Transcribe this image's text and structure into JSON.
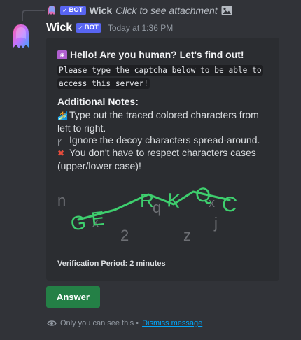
{
  "reply": {
    "author": "Wick",
    "bot_tag": "BOT",
    "text": "Click to see attachment",
    "icon": "image-icon"
  },
  "message": {
    "author": "Wick",
    "bot_tag": "BOT",
    "timestamp": "Today at 1:36 PM"
  },
  "embed": {
    "title": "Hello! Are you human? Let's find out!",
    "title_emoji": "robot-face-icon",
    "instructions_code": "Please type the captcha below to be able to access this server!",
    "notes_heading": "Additional Notes:",
    "notes": [
      {
        "icon": "person-tracing-icon",
        "text": "Type out the traced colored characters from left to right."
      },
      {
        "icon": "ignore-icon",
        "text": "Ignore the decoy characters spread-around."
      },
      {
        "icon": "cross-mark-icon",
        "text": "You don't have to respect characters cases (upper/lower case)!"
      }
    ],
    "captcha": {
      "traced_characters": [
        "G",
        "E",
        "R",
        "K",
        "Q",
        "C"
      ],
      "decoy_characters": [
        "n",
        "x",
        "2",
        "q",
        "z",
        "x",
        "j"
      ],
      "trace_color": "#3ecf6e",
      "decoy_color": "#6d6f74"
    },
    "footer": "Verification Period: 2 minutes",
    "accent_color": "#2b2d31"
  },
  "actions": {
    "answer_label": "Answer",
    "answer_color": "#248046"
  },
  "ephemeral": {
    "notice": "Only you can see this •",
    "dismiss_label": "Dismiss message"
  }
}
